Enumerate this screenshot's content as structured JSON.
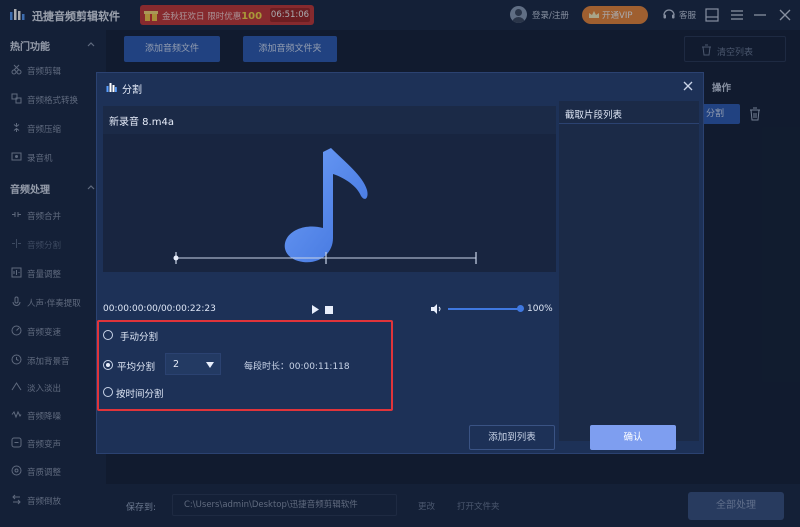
{
  "app": {
    "title": "迅捷音频剪辑软件",
    "promo_text_a": "金秋狂欢日 限时优惠",
    "promo_number": "100",
    "promo_timer": "06:51:06",
    "login": "登录/注册",
    "vip": "开通VIP",
    "service": "客服"
  },
  "sidebar": {
    "section1": "热门功能",
    "items1": [
      "音频剪辑",
      "音频格式转换",
      "音频压缩",
      "录音机"
    ],
    "section2": "音频处理",
    "items2": [
      "音频合并",
      "音频分割",
      "音量调整",
      "人声·伴奏提取",
      "音频变速",
      "添加背景音",
      "淡入淡出",
      "音频降噪",
      "音频变声",
      "音质调整",
      "音频倒放"
    ]
  },
  "main": {
    "add_file": "添加音频文件",
    "add_folder": "添加音频文件夹",
    "clear_list": "清空列表",
    "op_header": "操作",
    "split_small": "分割",
    "save_to": "保存到:",
    "path": "C:\\Users\\admin\\Desktop\\迅捷音频剪辑软件",
    "change": "更改",
    "open_folder": "打开文件夹",
    "process_all": "全部处理"
  },
  "dialog": {
    "title": "分割",
    "file_name": "新录音 8.m4a",
    "time": "00:00:00:00/00:00:22:23",
    "volume": "100%",
    "clip_list_title": "截取片段列表",
    "opt_manual": "手动分割",
    "opt_average": "平均分割",
    "segments": "2",
    "segment_length": "每段时长：00:00:11:118",
    "opt_time": "按时间分割",
    "add_to_list": "添加到列表",
    "confirm": "确认"
  },
  "colors": {
    "accent": "#2f5fb8",
    "highlight_border": "#e0343a",
    "confirm": "#7e9ef0",
    "promo": "#c93a3a",
    "vip": "#f08a3c"
  }
}
